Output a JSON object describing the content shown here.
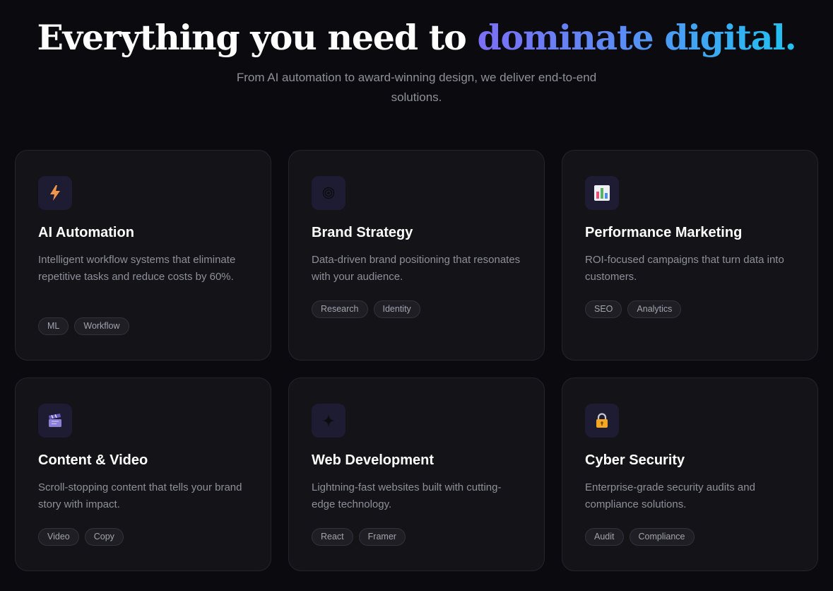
{
  "hero": {
    "title_main": "Everything you need to",
    "title_accent": "dominate digital.",
    "subtitle": "From AI automation to award-winning design, we deliver end-to-end solutions."
  },
  "colors": {
    "background": "#0b0b0f",
    "card": "#131318",
    "accent_start": "#7b6ef6",
    "accent_end": "#1fc3f0"
  },
  "services": [
    {
      "icon": "lightning-icon",
      "title": "AI Automation",
      "description": "Intelligent workflow systems that eliminate repetitive tasks and reduce costs by 60%.",
      "tags": [
        "ML",
        "Workflow"
      ]
    },
    {
      "icon": "target-icon",
      "title": "Brand Strategy",
      "description": "Data-driven brand positioning that resonates with your audience.",
      "tags": [
        "Research",
        "Identity"
      ]
    },
    {
      "icon": "bar-chart-icon",
      "title": "Performance Marketing",
      "description": "ROI-focused campaigns that turn data into customers.",
      "tags": [
        "SEO",
        "Analytics"
      ]
    },
    {
      "icon": "clapperboard-icon",
      "title": "Content & Video",
      "description": "Scroll-stopping content that tells your brand story with impact.",
      "tags": [
        "Video",
        "Copy"
      ]
    },
    {
      "icon": "sparkle-icon",
      "title": "Web Development",
      "description": "Lightning-fast websites built with cutting-edge technology.",
      "tags": [
        "React",
        "Framer"
      ]
    },
    {
      "icon": "lock-icon",
      "title": "Cyber Security",
      "description": "Enterprise-grade security audits and compliance solutions.",
      "tags": [
        "Audit",
        "Compliance"
      ]
    }
  ]
}
